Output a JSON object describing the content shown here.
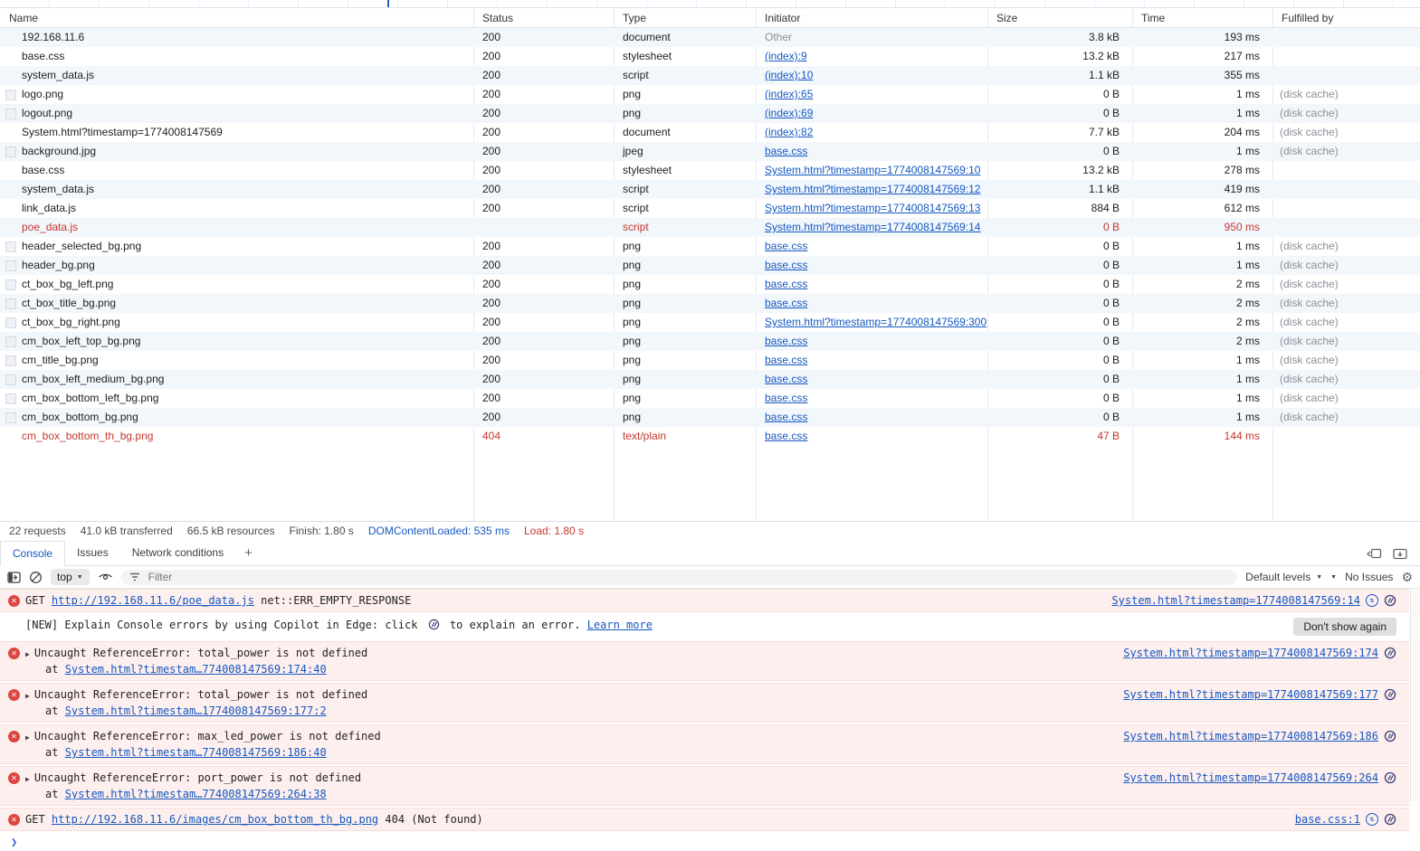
{
  "icons": {
    "error": "✕",
    "request": "⇅",
    "expand": "▶",
    "caret": "▼",
    "plus": "+",
    "gear": "⚙",
    "prompt": "❯"
  },
  "colors": {
    "link_blue": "#1658c0",
    "error_red": "#c5372c",
    "error_bg": "#fdefee",
    "row_stripe": "#f2f7fc",
    "overview_marker": "#2363c5"
  },
  "network": {
    "columns": [
      "Name",
      "Status",
      "Type",
      "Initiator",
      "Size",
      "Time",
      "Fulfilled by"
    ],
    "rows": [
      {
        "name": "192.168.11.6",
        "status": "200",
        "type": "document",
        "initiator": "Other",
        "init_kind": "plain",
        "size": "3.8 kB",
        "time": "193 ms",
        "fulfilled": "",
        "img": false,
        "error": false
      },
      {
        "name": "base.css",
        "status": "200",
        "type": "stylesheet",
        "initiator": "(index):9",
        "init_kind": "link",
        "size": "13.2 kB",
        "time": "217 ms",
        "fulfilled": "",
        "img": false,
        "error": false
      },
      {
        "name": "system_data.js",
        "status": "200",
        "type": "script",
        "initiator": "(index):10",
        "init_kind": "link",
        "size": "1.1 kB",
        "time": "355 ms",
        "fulfilled": "",
        "img": false,
        "error": false
      },
      {
        "name": "logo.png",
        "status": "200",
        "type": "png",
        "initiator": "(index):65",
        "init_kind": "link",
        "size": "0 B",
        "time": "1 ms",
        "fulfilled": "(disk cache)",
        "img": true,
        "error": false
      },
      {
        "name": "logout.png",
        "status": "200",
        "type": "png",
        "initiator": "(index):69",
        "init_kind": "link",
        "size": "0 B",
        "time": "1 ms",
        "fulfilled": "(disk cache)",
        "img": true,
        "error": false
      },
      {
        "name": "System.html?timestamp=1774008147569",
        "status": "200",
        "type": "document",
        "initiator": "(index):82",
        "init_kind": "link",
        "size": "7.7 kB",
        "time": "204 ms",
        "fulfilled": "(disk cache)",
        "img": false,
        "error": false
      },
      {
        "name": "background.jpg",
        "status": "200",
        "type": "jpeg",
        "initiator": "base.css",
        "init_kind": "link",
        "size": "0 B",
        "time": "1 ms",
        "fulfilled": "(disk cache)",
        "img": true,
        "error": false
      },
      {
        "name": "base.css",
        "status": "200",
        "type": "stylesheet",
        "initiator": "System.html?timestamp=1774008147569:10",
        "init_kind": "link",
        "size": "13.2 kB",
        "time": "278 ms",
        "fulfilled": "",
        "img": false,
        "error": false
      },
      {
        "name": "system_data.js",
        "status": "200",
        "type": "script",
        "initiator": "System.html?timestamp=1774008147569:12",
        "init_kind": "link",
        "size": "1.1 kB",
        "time": "419 ms",
        "fulfilled": "",
        "img": false,
        "error": false
      },
      {
        "name": "link_data.js",
        "status": "200",
        "type": "script",
        "initiator": "System.html?timestamp=1774008147569:13",
        "init_kind": "link",
        "size": "884 B",
        "time": "612 ms",
        "fulfilled": "",
        "img": false,
        "error": false
      },
      {
        "name": "poe_data.js",
        "status": "",
        "type": "script",
        "initiator": "System.html?timestamp=1774008147569:14",
        "init_kind": "link",
        "size": "0 B",
        "time": "950 ms",
        "fulfilled": "",
        "img": false,
        "error": true
      },
      {
        "name": "header_selected_bg.png",
        "status": "200",
        "type": "png",
        "initiator": "base.css",
        "init_kind": "link",
        "size": "0 B",
        "time": "1 ms",
        "fulfilled": "(disk cache)",
        "img": true,
        "error": false
      },
      {
        "name": "header_bg.png",
        "status": "200",
        "type": "png",
        "initiator": "base.css",
        "init_kind": "link",
        "size": "0 B",
        "time": "1 ms",
        "fulfilled": "(disk cache)",
        "img": true,
        "error": false
      },
      {
        "name": "ct_box_bg_left.png",
        "status": "200",
        "type": "png",
        "initiator": "base.css",
        "init_kind": "link",
        "size": "0 B",
        "time": "2 ms",
        "fulfilled": "(disk cache)",
        "img": true,
        "error": false
      },
      {
        "name": "ct_box_title_bg.png",
        "status": "200",
        "type": "png",
        "initiator": "base.css",
        "init_kind": "link",
        "size": "0 B",
        "time": "2 ms",
        "fulfilled": "(disk cache)",
        "img": true,
        "error": false
      },
      {
        "name": "ct_box_bg_right.png",
        "status": "200",
        "type": "png",
        "initiator": "System.html?timestamp=1774008147569:300",
        "init_kind": "link",
        "size": "0 B",
        "time": "2 ms",
        "fulfilled": "(disk cache)",
        "img": true,
        "error": false
      },
      {
        "name": "cm_box_left_top_bg.png",
        "status": "200",
        "type": "png",
        "initiator": "base.css",
        "init_kind": "link",
        "size": "0 B",
        "time": "2 ms",
        "fulfilled": "(disk cache)",
        "img": true,
        "error": false
      },
      {
        "name": "cm_title_bg.png",
        "status": "200",
        "type": "png",
        "initiator": "base.css",
        "init_kind": "link",
        "size": "0 B",
        "time": "1 ms",
        "fulfilled": "(disk cache)",
        "img": true,
        "error": false
      },
      {
        "name": "cm_box_left_medium_bg.png",
        "status": "200",
        "type": "png",
        "initiator": "base.css",
        "init_kind": "link",
        "size": "0 B",
        "time": "1 ms",
        "fulfilled": "(disk cache)",
        "img": true,
        "error": false
      },
      {
        "name": "cm_box_bottom_left_bg.png",
        "status": "200",
        "type": "png",
        "initiator": "base.css",
        "init_kind": "link",
        "size": "0 B",
        "time": "1 ms",
        "fulfilled": "(disk cache)",
        "img": true,
        "error": false
      },
      {
        "name": "cm_box_bottom_bg.png",
        "status": "200",
        "type": "png",
        "initiator": "base.css",
        "init_kind": "link",
        "size": "0 B",
        "time": "1 ms",
        "fulfilled": "(disk cache)",
        "img": true,
        "error": false
      },
      {
        "name": "cm_box_bottom_th_bg.png",
        "status": "404",
        "type": "text/plain",
        "initiator": "base.css",
        "init_kind": "link",
        "size": "47 B",
        "time": "144 ms",
        "fulfilled": "",
        "img": false,
        "error": true
      }
    ],
    "summary": {
      "requests": "22 requests",
      "transferred": "41.0 kB transferred",
      "resources": "66.5 kB resources",
      "finish": "Finish: 1.80 s",
      "dcl": "DOMContentLoaded: 535 ms",
      "load": "Load: 1.80 s"
    }
  },
  "console": {
    "tabs": [
      "Console",
      "Issues",
      "Network conditions"
    ],
    "toolbar": {
      "context": "top",
      "filter_placeholder": "Filter",
      "levels": "Default levels",
      "issues": "No Issues"
    },
    "at_label": "at",
    "net_error": {
      "method": "GET",
      "url": "http://192.168.11.6/poe_data.js",
      "detail": "net::ERR_EMPTY_RESPONSE",
      "source": "System.html?timestamp=1774008147569:14"
    },
    "banner": {
      "text_before": "[NEW] Explain Console errors by using Copilot in Edge: click",
      "text_after": "to explain an error.",
      "link": "Learn more",
      "button": "Don't show again"
    },
    "errors": [
      {
        "message": "Uncaught ReferenceError: total_power is not defined",
        "location": "System.html?timestam…774008147569:174:40",
        "source": "System.html?timestamp=1774008147569:174"
      },
      {
        "message": "Uncaught ReferenceError: total_power is not defined",
        "location": "System.html?timestam…1774008147569:177:2",
        "source": "System.html?timestamp=1774008147569:177"
      },
      {
        "message": "Uncaught ReferenceError: max_led_power is not defined",
        "location": "System.html?timestam…774008147569:186:40",
        "source": "System.html?timestamp=1774008147569:186"
      },
      {
        "message": "Uncaught ReferenceError: port_power is not defined",
        "location": "System.html?timestam…774008147569:264:38",
        "source": "System.html?timestamp=1774008147569:264"
      }
    ],
    "not_found": {
      "method": "GET",
      "url": "http://192.168.11.6/images/cm_box_bottom_th_bg.png",
      "detail": "404 (Not found)",
      "source": "base.css:1"
    }
  }
}
